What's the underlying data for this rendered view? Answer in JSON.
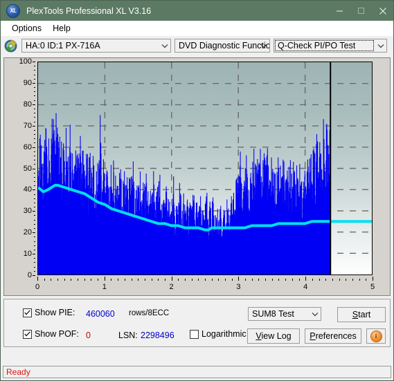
{
  "window": {
    "title": "PlexTools Professional XL V3.16",
    "icon": "xl-app-icon",
    "icon_text": "XL",
    "minimize": "minimize-icon",
    "maximize": "maximize-icon",
    "close": "close-icon"
  },
  "menubar": {
    "items": [
      {
        "label": "Options"
      },
      {
        "label": "Help"
      }
    ]
  },
  "toolbar": {
    "disc_icon": "disc-icon",
    "drive": {
      "value": "HA:0 ID:1  PX-716A"
    },
    "function": {
      "value": "DVD Diagnostic Functions"
    },
    "test": {
      "value": "Q-Check PI/PO Test"
    }
  },
  "controls": {
    "show_pie": {
      "label": "Show PIE:",
      "checked": true,
      "value": "460060",
      "unit": "rows/8ECC"
    },
    "show_pof": {
      "label": "Show POF:",
      "checked": true,
      "value": "0"
    },
    "lsn": {
      "label": "LSN:",
      "value": "2298496"
    },
    "logarithmic": {
      "label": "Logarithmic",
      "checked": false
    },
    "test_mode": {
      "value": "SUM8 Test"
    },
    "start_button": {
      "label": "Start",
      "accel": "S"
    },
    "view_log_button": {
      "label": "View Log",
      "accel": "V"
    },
    "preferences_button": {
      "label": "Preferences",
      "accel": "P"
    },
    "info_button": {
      "label": "i",
      "icon": "info-icon"
    }
  },
  "statusbar": {
    "text": "Ready"
  },
  "chart_data": {
    "type": "line",
    "title": "",
    "xlabel": "",
    "ylabel": "",
    "xlim": [
      0,
      5
    ],
    "ylim": [
      0,
      100
    ],
    "xticks": [
      0,
      1,
      2,
      3,
      4,
      5
    ],
    "yticks": [
      0,
      10,
      20,
      30,
      40,
      50,
      60,
      70,
      80,
      90,
      100
    ],
    "grid": true,
    "legend": "none",
    "data_end_x": 4.38,
    "series": [
      {
        "name": "PIE (spikes)",
        "color": "#0000f4",
        "type": "area",
        "x": [
          0.0,
          0.03,
          0.05,
          0.08,
          0.1,
          0.13,
          0.15,
          0.18,
          0.2,
          0.23,
          0.25,
          0.28,
          0.3,
          0.33,
          0.35,
          0.38,
          0.4,
          0.43,
          0.45,
          0.48,
          0.5,
          0.53,
          0.55,
          0.58,
          0.6,
          0.63,
          0.65,
          0.68,
          0.7,
          0.73,
          0.75,
          0.78,
          0.8,
          0.83,
          0.85,
          0.88,
          0.9,
          0.93,
          0.95,
          0.98,
          1.0,
          1.03,
          1.05,
          1.08,
          1.1,
          1.13,
          1.15,
          1.18,
          1.2,
          1.23,
          1.25,
          1.28,
          1.3,
          1.33,
          1.35,
          1.38,
          1.4,
          1.43,
          1.45,
          1.48,
          1.5,
          1.53,
          1.55,
          1.58,
          1.6,
          1.63,
          1.65,
          1.68,
          1.7,
          1.73,
          1.75,
          1.78,
          1.8,
          1.83,
          1.85,
          1.88,
          1.9,
          1.93,
          1.95,
          1.98,
          2.0,
          2.03,
          2.05,
          2.08,
          2.1,
          2.13,
          2.15,
          2.18,
          2.2,
          2.23,
          2.25,
          2.28,
          2.3,
          2.33,
          2.35,
          2.38,
          2.4,
          2.43,
          2.45,
          2.48,
          2.5,
          2.53,
          2.55,
          2.58,
          2.6,
          2.63,
          2.65,
          2.68,
          2.7,
          2.73,
          2.75,
          2.78,
          2.8,
          2.83,
          2.85,
          2.88,
          2.9,
          2.93,
          2.95,
          2.98,
          3.0,
          3.03,
          3.05,
          3.08,
          3.1,
          3.13,
          3.15,
          3.18,
          3.2,
          3.23,
          3.25,
          3.28,
          3.3,
          3.33,
          3.35,
          3.38,
          3.4,
          3.43,
          3.45,
          3.48,
          3.5,
          3.53,
          3.55,
          3.58,
          3.6,
          3.63,
          3.65,
          3.68,
          3.7,
          3.73,
          3.75,
          3.78,
          3.8,
          3.83,
          3.85,
          3.88,
          3.9,
          3.93,
          3.95,
          3.98,
          4.0,
          4.03,
          4.05,
          4.08,
          4.1,
          4.13,
          4.15,
          4.18,
          4.2,
          4.23,
          4.25,
          4.28,
          4.3,
          4.33,
          4.35,
          4.38
        ],
        "y": [
          56,
          58,
          62,
          50,
          64,
          57,
          52,
          66,
          58,
          72,
          62,
          77,
          59,
          68,
          54,
          63,
          58,
          66,
          51,
          60,
          55,
          62,
          48,
          57,
          52,
          61,
          45,
          55,
          50,
          58,
          43,
          52,
          48,
          56,
          41,
          50,
          46,
          66,
          40,
          48,
          44,
          55,
          39,
          47,
          43,
          52,
          38,
          46,
          42,
          50,
          36,
          45,
          41,
          48,
          35,
          43,
          39,
          47,
          34,
          42,
          38,
          45,
          33,
          41,
          37,
          44,
          32,
          40,
          36,
          43,
          31,
          39,
          35,
          42,
          30,
          38,
          34,
          41,
          29,
          37,
          33,
          40,
          28,
          36,
          32,
          39,
          27,
          35,
          31,
          38,
          26,
          34,
          30,
          37,
          25,
          33,
          29,
          36,
          24,
          32,
          28,
          35,
          23,
          31,
          27,
          34,
          22,
          30,
          26,
          33,
          21,
          29,
          25,
          32,
          29,
          36,
          33,
          42,
          38,
          47,
          44,
          52,
          38,
          46,
          43,
          50,
          40,
          48,
          45,
          52,
          47,
          55,
          50,
          58,
          45,
          53,
          48,
          56,
          44,
          52,
          47,
          54,
          43,
          51,
          46,
          53,
          42,
          50,
          45,
          52,
          41,
          49,
          44,
          51,
          40,
          48,
          43,
          50,
          39,
          47,
          42,
          49,
          44,
          52,
          47,
          55,
          50,
          58,
          53,
          61,
          56,
          64,
          59,
          67,
          62,
          69
        ]
      },
      {
        "name": "PIE average",
        "color": "#00e0f0",
        "type": "line",
        "x": [
          0.0,
          0.08,
          0.15,
          0.2,
          0.25,
          0.3,
          0.4,
          0.5,
          0.6,
          0.7,
          0.8,
          0.9,
          1.0,
          1.1,
          1.2,
          1.3,
          1.4,
          1.5,
          1.6,
          1.7,
          1.8,
          1.9,
          2.0,
          2.1,
          2.2,
          2.3,
          2.4,
          2.5,
          2.55,
          2.6,
          2.7,
          2.8,
          2.9,
          3.0,
          3.1,
          3.2,
          3.3,
          3.4,
          3.5,
          3.6,
          3.7,
          3.8,
          3.9,
          4.0,
          4.1,
          4.2,
          4.3,
          4.38,
          4.6,
          5.0
        ],
        "y": [
          41,
          39,
          40,
          41,
          42,
          42,
          41,
          40,
          39,
          38,
          36,
          34,
          33,
          31,
          30,
          29,
          28,
          27,
          26,
          25,
          24,
          24,
          23,
          23,
          22,
          22,
          22,
          21,
          21,
          22,
          22,
          22,
          22,
          22,
          22,
          23,
          23,
          23,
          23,
          24,
          24,
          24,
          24,
          24,
          25,
          25,
          25,
          25,
          25,
          25
        ]
      }
    ]
  }
}
